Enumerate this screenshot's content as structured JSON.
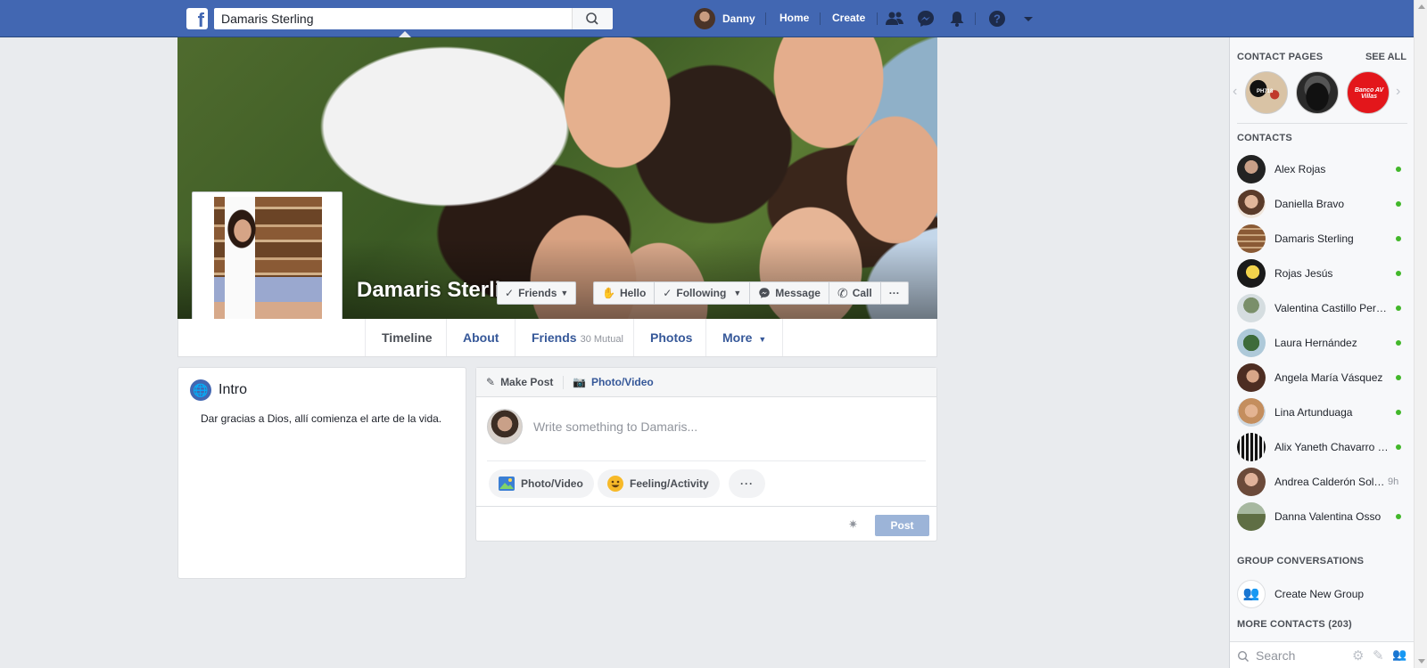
{
  "topbar": {
    "search_value": "Damaris Sterling",
    "user_name": "Danny",
    "home": "Home",
    "create": "Create",
    "color": "#4267b2"
  },
  "profile": {
    "name": "Damaris Sterling",
    "actions": {
      "friends": "Friends",
      "hello": "Hello",
      "following": "Following",
      "message": "Message",
      "call": "Call",
      "more": "···"
    }
  },
  "tabs": {
    "timeline": "Timeline",
    "about": "About",
    "friends": "Friends",
    "friends_mutual": "30 Mutual",
    "photos": "Photos",
    "more": "More"
  },
  "intro": {
    "title": "Intro",
    "bio": "Dar gracias a Dios, allí comienza el arte de la vida."
  },
  "composer": {
    "make_post": "Make Post",
    "photo_video_tab": "Photo/Video",
    "placeholder": "Write something to Damaris...",
    "photo_video": "Photo/Video",
    "feeling": "Feeling/Activity",
    "more": "···",
    "post": "Post"
  },
  "sidebar": {
    "contact_pages": "CONTACT PAGES",
    "see_all": "SEE ALL",
    "contacts_heading": "CONTACTS",
    "contacts": [
      {
        "name": "Alex Rojas",
        "status": "online"
      },
      {
        "name": "Daniella Bravo",
        "status": "online"
      },
      {
        "name": "Damaris Sterling",
        "status": "online"
      },
      {
        "name": "Rojas Jesús",
        "status": "online"
      },
      {
        "name": "Valentina Castillo Peralta",
        "status": "online"
      },
      {
        "name": "Laura Hernández",
        "status": "online"
      },
      {
        "name": "Angela María Vásquez",
        "status": "online"
      },
      {
        "name": "Lina Artunduaga",
        "status": "online"
      },
      {
        "name": "Alix Yaneth Chavarro Cortés",
        "status": "online"
      },
      {
        "name": "Andrea Calderón Solano",
        "status": "idle",
        "time": "9h"
      },
      {
        "name": "Danna Valentina Osso",
        "status": "online"
      }
    ],
    "group_conversations": "GROUP CONVERSATIONS",
    "create_group": "Create New Group",
    "more_contacts": "MORE CONTACTS (203)",
    "search_placeholder": "Search",
    "page_badge_1": "PH718",
    "page_badge_3": "Banco AV Villas"
  }
}
